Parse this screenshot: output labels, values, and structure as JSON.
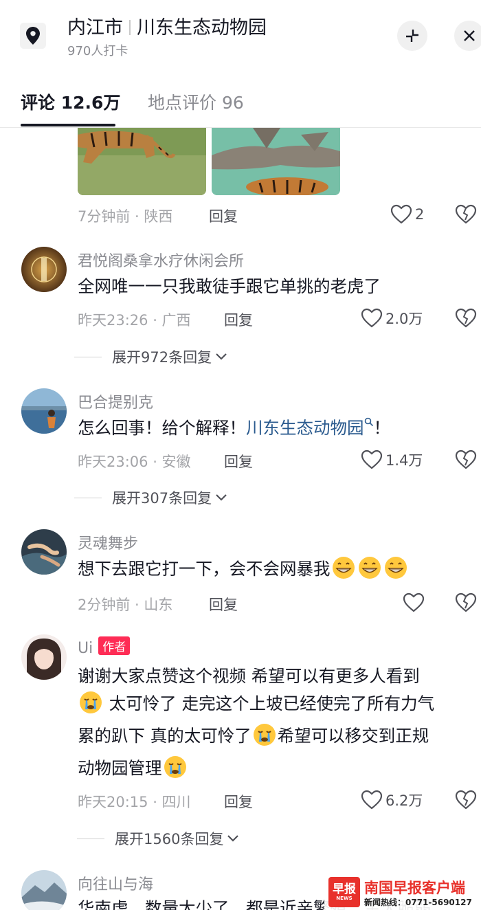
{
  "header": {
    "city": "内江市",
    "place": "川东生态动物园",
    "checkins": "970人打卡",
    "tabs": [
      {
        "label": "评论 12.6万",
        "active": true
      },
      {
        "label": "地点评价 96",
        "active": false
      }
    ]
  },
  "comments": [
    {
      "time_loc": "7分钟前 · 陕西",
      "reply": "回复",
      "likes": "2"
    },
    {
      "user": "君悦阁桑拿水疗休闲会所",
      "text": "全网唯一一只我敢徒手跟它单挑的老虎了",
      "time_loc": "昨天23:26 · 广西",
      "reply": "回复",
      "likes": "2.0万",
      "expand": "展开972条回复"
    },
    {
      "user": "巴合提别克",
      "text_before": "怎么回事！给个解释！",
      "text_link": "川东生态动物园",
      "text_after": "！",
      "time_loc": "昨天23:06 · 安徽",
      "reply": "回复",
      "likes": "1.4万",
      "expand": "展开307条回复"
    },
    {
      "user": "灵魂舞步",
      "text": "想下去跟它打一下，会不会网暴我",
      "time_loc": "2分钟前 · 山东",
      "reply": "回复",
      "likes": ""
    },
    {
      "user": "Ui",
      "badge": "作者",
      "lines": [
        "谢谢大家点赞这个视频 希望可以有更多人看到",
        "太可怜了 走完这个上坡已经使完了所有力气",
        "累的趴下 真的太可怜了",
        "希望可以移交到正规",
        "动物园管理"
      ],
      "time_loc": "昨天20:15 · 四川",
      "reply": "回复",
      "likes": "6.2万",
      "expand": "展开1560条回复"
    },
    {
      "user": "向往山与海",
      "text": "华南虎，数量太少了，都是近亲繁殖，生太脆弱"
    }
  ],
  "watermark": {
    "logo": "早报",
    "logo_sub": "NEWS",
    "title": "南国早报客户端",
    "hotline": "新闻热线：0771-5690127"
  },
  "colors": {
    "text": "#161823",
    "muted": "#8a8b91",
    "link": "#2a5a8e",
    "badge": "#fe2c55",
    "watermark": "#e8312b"
  }
}
